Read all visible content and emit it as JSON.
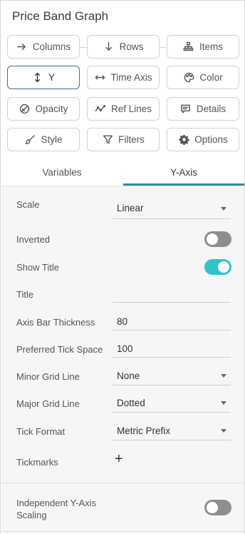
{
  "panel": {
    "title": "Price Band Graph"
  },
  "buttons": {
    "columns": "Columns",
    "rows": "Rows",
    "items": "Items",
    "y": "Y",
    "time_axis": "Time Axis",
    "color": "Color",
    "opacity": "Opacity",
    "ref_lines": "Ref Lines",
    "details": "Details",
    "style": "Style",
    "filters": "Filters",
    "options": "Options"
  },
  "tabs": {
    "variables": "Variables",
    "y_axis": "Y-Axis",
    "active": "Y-Axis"
  },
  "settings": {
    "scale": {
      "label": "Scale",
      "value": "Linear"
    },
    "inverted": {
      "label": "Inverted",
      "on": false
    },
    "show_title": {
      "label": "Show Title",
      "on": true
    },
    "title": {
      "label": "Title",
      "value": ""
    },
    "axis_bar_thickness": {
      "label": "Axis Bar Thickness",
      "value": "80"
    },
    "preferred_tick_space": {
      "label": "Preferred Tick Space",
      "value": "100"
    },
    "minor_grid_line": {
      "label": "Minor Grid Line",
      "value": "None"
    },
    "major_grid_line": {
      "label": "Major Grid Line",
      "value": "Dotted"
    },
    "tick_format": {
      "label": "Tick Format",
      "value": "Metric Prefix"
    },
    "tickmarks": {
      "label": "Tickmarks",
      "add": "+"
    },
    "independent_scaling": {
      "label_line1": "Independent Y-Axis",
      "label_line2": "Scaling",
      "on": false
    }
  },
  "colors": {
    "accent": "#2e8ba6",
    "toggle_on": "#2ec4c9",
    "toggle_off": "#8e8e8e"
  }
}
